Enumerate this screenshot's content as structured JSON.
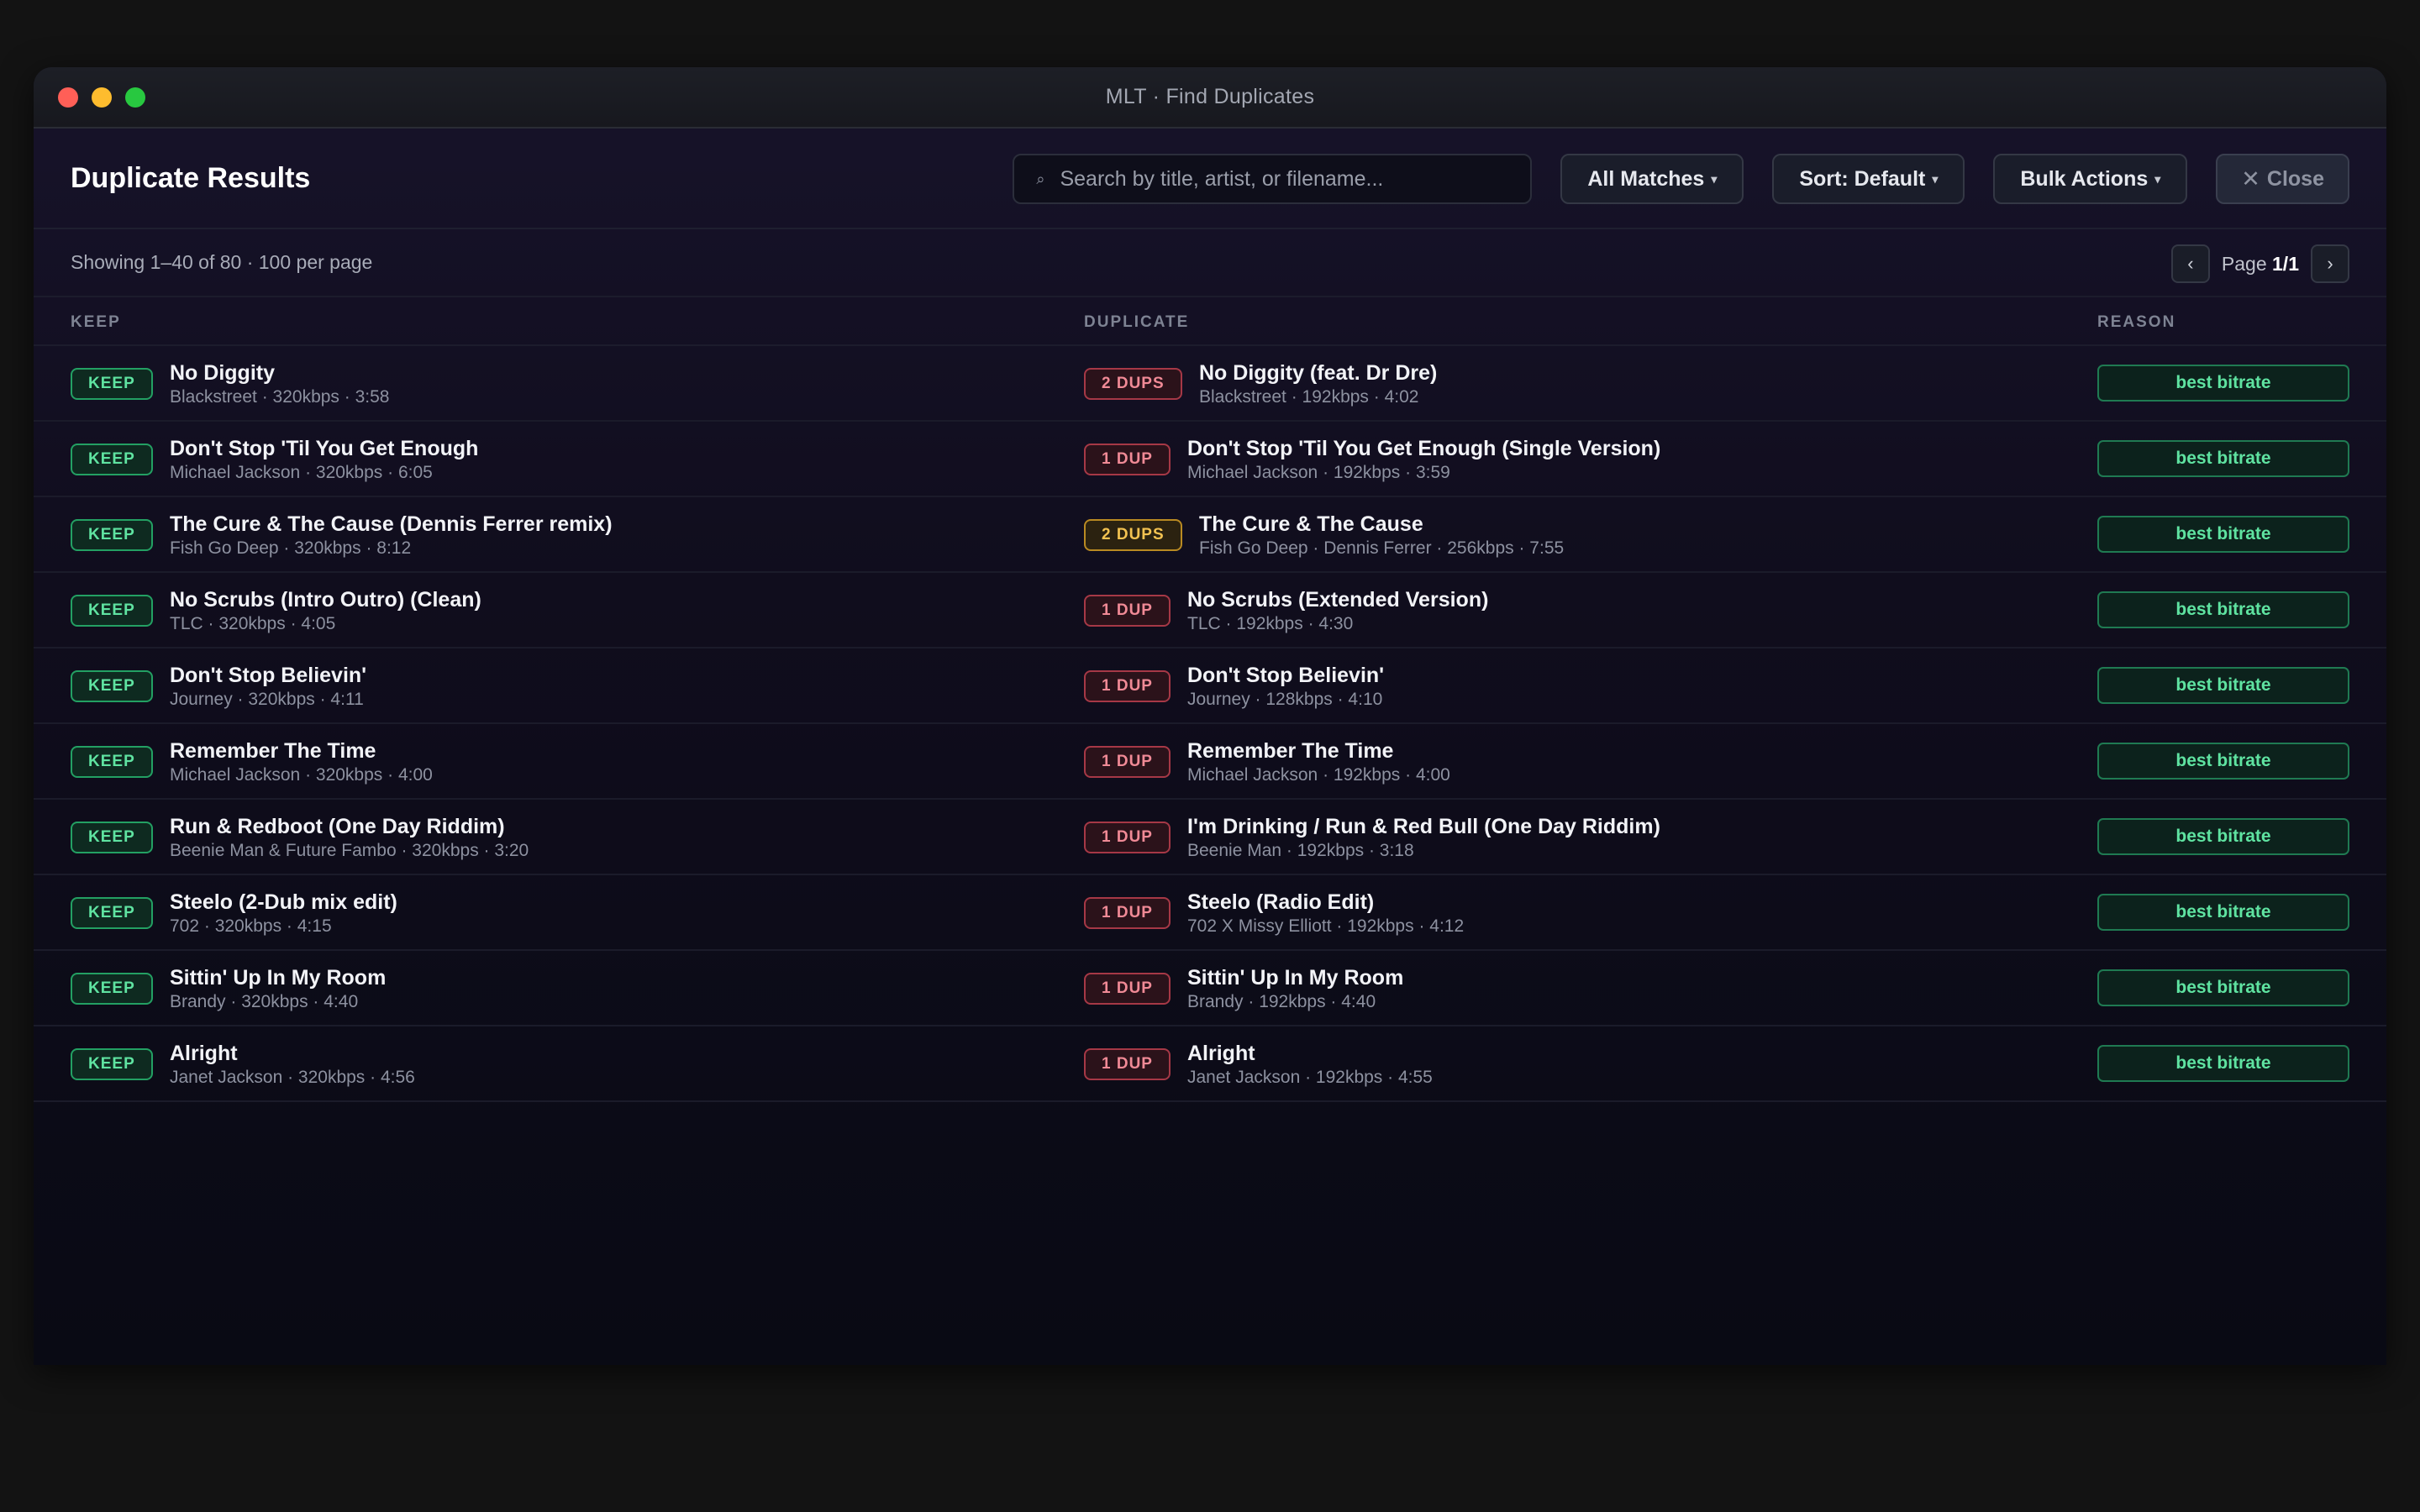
{
  "window": {
    "title": "MLT · Find Duplicates"
  },
  "toolbar": {
    "title": "Duplicate Results",
    "search_placeholder": "Search by title, artist, or filename...",
    "search_icon": "⌕",
    "filter_label": "All Matches",
    "sort_label": "Sort: Default",
    "bulk_label": "Bulk Actions",
    "caret": "▾",
    "close_icon": "✕",
    "close_label": "Close"
  },
  "status": {
    "text": "Showing 1–40 of 80 · 100 per page",
    "page_prefix": "Page",
    "page_value": "1/1",
    "prev_icon": "‹",
    "next_icon": "›"
  },
  "columns": {
    "keep": "KEEP",
    "duplicate": "DUPLICATE",
    "reason": "REASON"
  },
  "colors": {
    "keep_green": "#5fe3a1",
    "dup_red": "#f08a96",
    "dup_amber": "#f3c251"
  },
  "rows": [
    {
      "keep_badge": "KEEP",
      "keep_title": "No Diggity",
      "keep_meta": "Blackstreet · 320kbps · 3:58",
      "dup_badge": "2 DUPS",
      "dup_badge_style": "red",
      "dup_title": "No Diggity (feat. Dr Dre)",
      "dup_meta": "Blackstreet · 192kbps · 4:02",
      "reason": "best bitrate"
    },
    {
      "keep_badge": "KEEP",
      "keep_title": "Don't Stop 'Til You Get Enough",
      "keep_meta": "Michael Jackson · 320kbps · 6:05",
      "dup_badge": "1 DUP",
      "dup_badge_style": "red",
      "dup_title": "Don't Stop 'Til You Get Enough (Single Version)",
      "dup_meta": "Michael Jackson · 192kbps · 3:59",
      "reason": "best bitrate"
    },
    {
      "keep_badge": "KEEP",
      "keep_title": "The Cure & The Cause (Dennis Ferrer remix)",
      "keep_meta": "Fish Go Deep · 320kbps · 8:12",
      "dup_badge": "2 DUPS",
      "dup_badge_style": "amber",
      "dup_title": "The Cure & The Cause",
      "dup_meta": "Fish Go Deep · Dennis Ferrer · 256kbps · 7:55",
      "reason": "best bitrate"
    },
    {
      "keep_badge": "KEEP",
      "keep_title": "No Scrubs (Intro Outro) (Clean)",
      "keep_meta": "TLC · 320kbps · 4:05",
      "dup_badge": "1 DUP",
      "dup_badge_style": "red",
      "dup_title": "No Scrubs (Extended Version)",
      "dup_meta": "TLC · 192kbps · 4:30",
      "reason": "best bitrate"
    },
    {
      "keep_badge": "KEEP",
      "keep_title": "Don't Stop Believin'",
      "keep_meta": "Journey · 320kbps · 4:11",
      "dup_badge": "1 DUP",
      "dup_badge_style": "red",
      "dup_title": "Don't Stop Believin'",
      "dup_meta": "Journey · 128kbps · 4:10",
      "reason": "best bitrate"
    },
    {
      "keep_badge": "KEEP",
      "keep_title": "Remember The Time",
      "keep_meta": "Michael Jackson · 320kbps · 4:00",
      "dup_badge": "1 DUP",
      "dup_badge_style": "red",
      "dup_title": "Remember The Time",
      "dup_meta": "Michael Jackson · 192kbps · 4:00",
      "reason": "best bitrate"
    },
    {
      "keep_badge": "KEEP",
      "keep_title": "Run & Redboot (One Day Riddim)",
      "keep_meta": "Beenie Man & Future Fambo · 320kbps · 3:20",
      "dup_badge": "1 DUP",
      "dup_badge_style": "red",
      "dup_title": "I'm Drinking / Run & Red Bull (One Day Riddim)",
      "dup_meta": "Beenie Man · 192kbps · 3:18",
      "reason": "best bitrate"
    },
    {
      "keep_badge": "KEEP",
      "keep_title": "Steelo (2-Dub mix edit)",
      "keep_meta": "702 · 320kbps · 4:15",
      "dup_badge": "1 DUP",
      "dup_badge_style": "red",
      "dup_title": "Steelo (Radio Edit)",
      "dup_meta": "702 X Missy Elliott · 192kbps · 4:12",
      "reason": "best bitrate"
    },
    {
      "keep_badge": "KEEP",
      "keep_title": "Sittin' Up In My Room",
      "keep_meta": "Brandy · 320kbps · 4:40",
      "dup_badge": "1 DUP",
      "dup_badge_style": "red",
      "dup_title": "Sittin' Up In My Room",
      "dup_meta": "Brandy · 192kbps · 4:40",
      "reason": "best bitrate"
    },
    {
      "keep_badge": "KEEP",
      "keep_title": "Alright",
      "keep_meta": "Janet Jackson · 320kbps · 4:56",
      "dup_badge": "1 DUP",
      "dup_badge_style": "red",
      "dup_title": "Alright",
      "dup_meta": "Janet Jackson · 192kbps · 4:55",
      "reason": "best bitrate"
    }
  ]
}
